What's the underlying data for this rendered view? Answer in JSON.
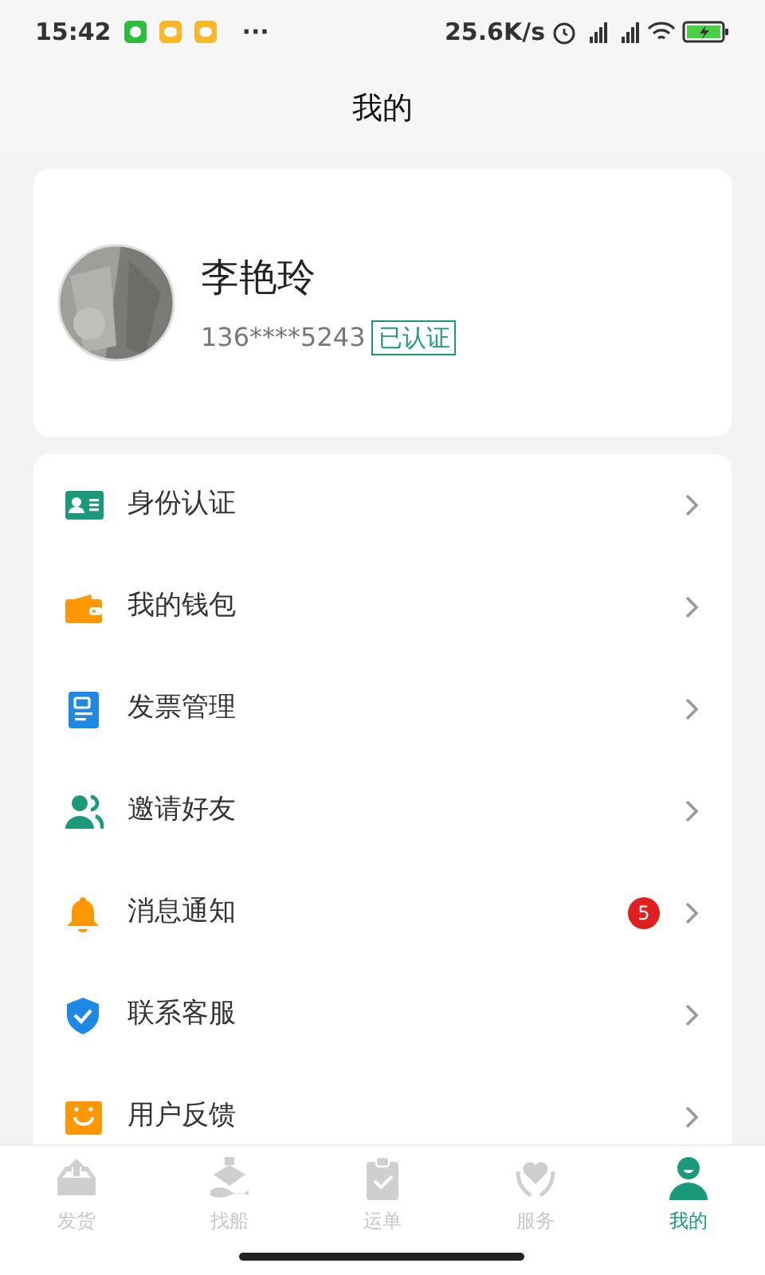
{
  "status_bar": {
    "time": "15:42",
    "dots": "···",
    "net_speed": "25.6K/s"
  },
  "header": {
    "title": "我的"
  },
  "profile": {
    "name": "李艳玲",
    "phone": "136****5243",
    "verified_label": "已认证"
  },
  "menu": [
    {
      "kind": "id-card",
      "label": "身份认证"
    },
    {
      "kind": "wallet",
      "label": "我的钱包"
    },
    {
      "kind": "invoice",
      "label": "发票管理"
    },
    {
      "kind": "friends",
      "label": "邀请好友"
    },
    {
      "kind": "bell",
      "label": "消息通知",
      "badge": "5"
    },
    {
      "kind": "shield",
      "label": "联系客服"
    },
    {
      "kind": "feedback",
      "label": "用户反馈"
    }
  ],
  "tabs": [
    {
      "kind": "ship-out",
      "label": "发货",
      "selected": false
    },
    {
      "kind": "boat",
      "label": "找船",
      "selected": false
    },
    {
      "kind": "clipboard",
      "label": "运单",
      "selected": false
    },
    {
      "kind": "heart",
      "label": "服务",
      "selected": false
    },
    {
      "kind": "person",
      "label": "我的",
      "selected": true
    }
  ]
}
